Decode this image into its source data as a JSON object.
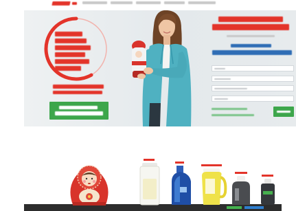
{
  "colors": {
    "brand_red": "#e3342a",
    "cta_green": "#3da64b",
    "heading_blue": "#2f6db5",
    "hero_background": "#e6eaec",
    "nav_grey": "#c8c8c8",
    "blazer_teal": "#4fb1c1"
  },
  "hero": {
    "illustration_icons": [
      "red-circle-badge",
      "woman-holding-pitcher",
      "matryoshka-pitcher"
    ]
  },
  "products": [
    {
      "icon": "matryoshka-doll",
      "color": "#d8342b"
    },
    {
      "icon": "white-filter-jug",
      "color": "#f6f6f1"
    },
    {
      "icon": "blue-filter-bottle",
      "color": "#1f4ea6"
    },
    {
      "icon": "yellow-filter-pitcher",
      "color": "#efe24a"
    },
    {
      "icon": "grey-filter-unit",
      "color": "#4a4c50"
    },
    {
      "icon": "dark-filter-unit",
      "color": "#35383c"
    }
  ]
}
